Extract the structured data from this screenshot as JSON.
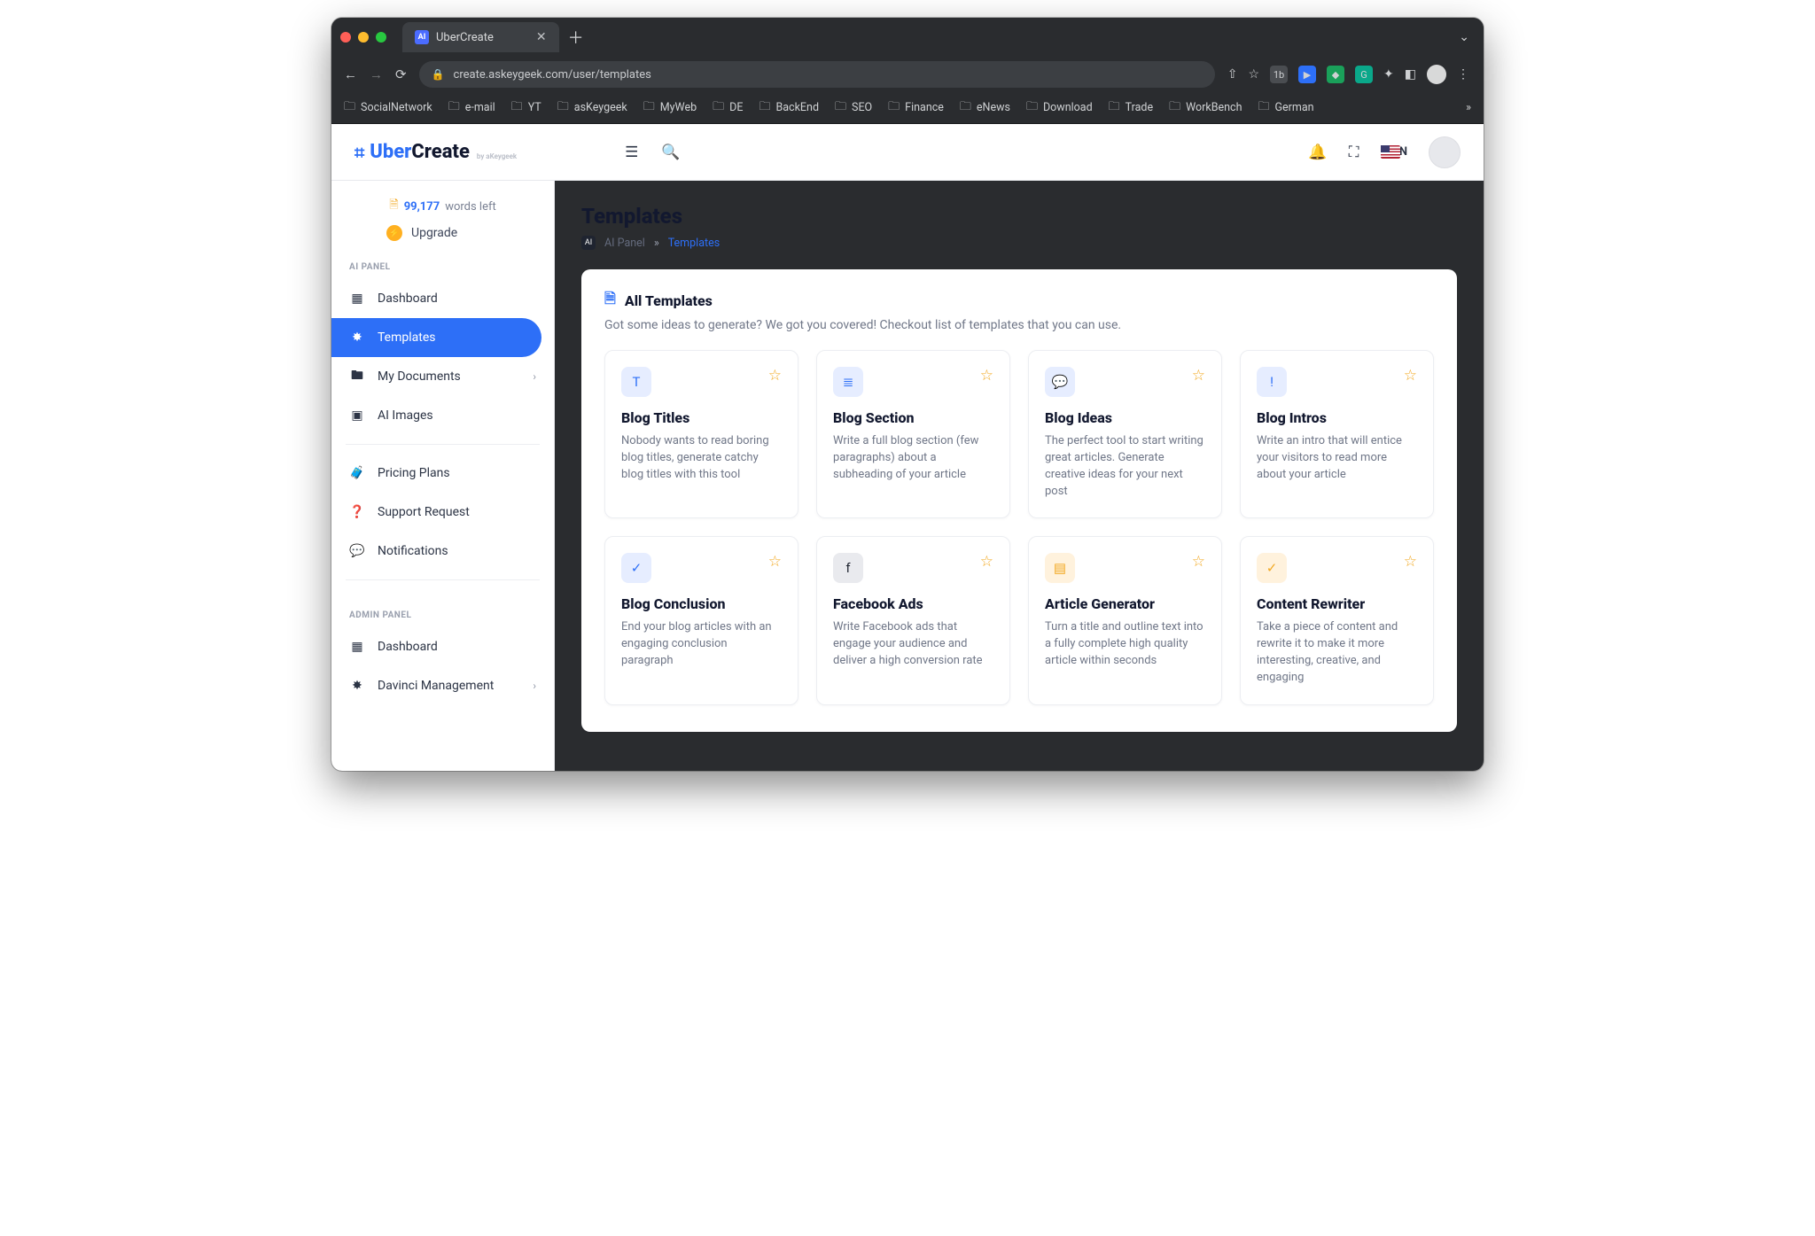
{
  "browser": {
    "tab_title": "UberCreate",
    "url_display": "create.askeygeek.com/user/templates",
    "bookmarks": [
      "SocialNetwork",
      "e-mail",
      "YT",
      "asKeygeek",
      "MyWeb",
      "DE",
      "BackEnd",
      "SEO",
      "Finance",
      "eNews",
      "Download",
      "Trade",
      "WorkBench",
      "German"
    ]
  },
  "header": {
    "brand_uber": "Uber",
    "brand_create": "Create",
    "brand_sub": "by aKeygeek",
    "lang": "EN"
  },
  "sidebar": {
    "words_count": "99,177",
    "words_label": "words left",
    "upgrade": "Upgrade",
    "sections": {
      "ai_panel": "AI PANEL",
      "admin_panel": "ADMIN PANEL"
    },
    "items_ai": [
      {
        "label": "Dashboard"
      },
      {
        "label": "Templates"
      },
      {
        "label": "My Documents"
      },
      {
        "label": "AI Images"
      }
    ],
    "items_mid": [
      {
        "label": "Pricing Plans"
      },
      {
        "label": "Support Request"
      },
      {
        "label": "Notifications"
      }
    ],
    "items_admin": [
      {
        "label": "Dashboard"
      },
      {
        "label": "Davinci Management"
      }
    ]
  },
  "page": {
    "title": "Templates",
    "crumb_root": "AI Panel",
    "crumb_current": "Templates"
  },
  "panel": {
    "title": "All Templates",
    "subtitle": "Got some ideas to generate? We got you covered! Checkout list of templates that you can use."
  },
  "templates": [
    {
      "title": "Blog Titles",
      "desc": "Nobody wants to read boring blog titles, generate catchy blog titles with this tool",
      "icon": "T",
      "variant": "blue"
    },
    {
      "title": "Blog Section",
      "desc": "Write a full blog section (few paragraphs) about a subheading of your article",
      "icon": "≣",
      "variant": "blue"
    },
    {
      "title": "Blog Ideas",
      "desc": "The perfect tool to start writing great articles. Generate creative ideas for your next post",
      "icon": "💬",
      "variant": "blue"
    },
    {
      "title": "Blog Intros",
      "desc": "Write an intro that will entice your visitors to read more about your article",
      "icon": "!",
      "variant": "blue"
    },
    {
      "title": "Blog Conclusion",
      "desc": "End your blog articles with an engaging conclusion paragraph",
      "icon": "✓",
      "variant": "blue"
    },
    {
      "title": "Facebook Ads",
      "desc": "Write Facebook ads that engage your audience and deliver a high conversion rate",
      "icon": "f",
      "variant": "dark"
    },
    {
      "title": "Article Generator",
      "desc": "Turn a title and outline text into a fully complete high quality article within seconds",
      "icon": "▤",
      "variant": "orange"
    },
    {
      "title": "Content Rewriter",
      "desc": "Take a piece of content and rewrite it to make it more interesting, creative, and engaging",
      "icon": "✓",
      "variant": "orange"
    }
  ]
}
